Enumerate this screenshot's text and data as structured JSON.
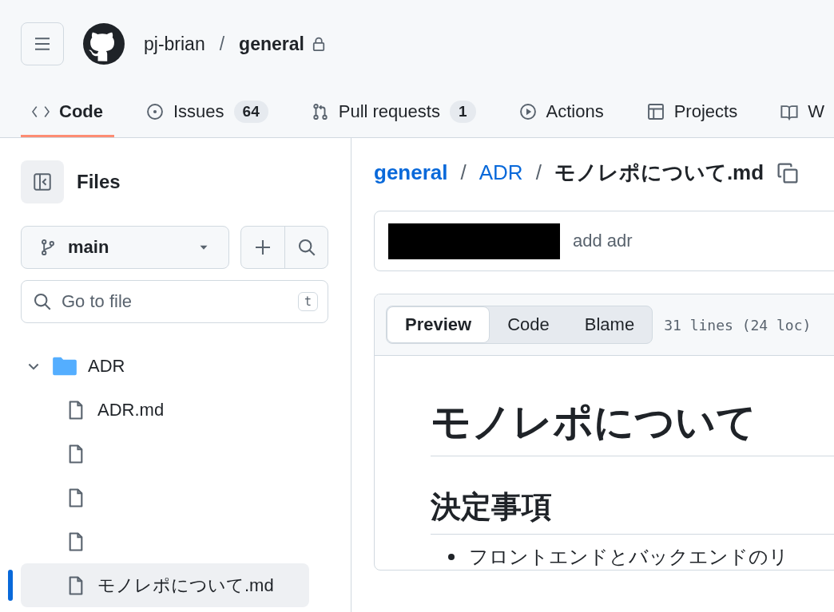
{
  "header": {
    "owner": "pj-brian",
    "separator": "/",
    "repo": "general",
    "private": true
  },
  "tabs": [
    {
      "kind": "code",
      "label": "Code",
      "selected": true
    },
    {
      "kind": "issues",
      "label": "Issues",
      "count": "64",
      "selected": false
    },
    {
      "kind": "pulls",
      "label": "Pull requests",
      "count": "1",
      "selected": false
    },
    {
      "kind": "actions",
      "label": "Actions",
      "selected": false
    },
    {
      "kind": "projects",
      "label": "Projects",
      "selected": false
    },
    {
      "kind": "wiki",
      "label": "W",
      "selected": false
    }
  ],
  "sidebar": {
    "title": "Files",
    "branch": "main",
    "search": {
      "placeholder": "Go to file",
      "shortcut": "t"
    },
    "tree": [
      {
        "kind": "folder",
        "name": "ADR",
        "expanded": true,
        "selected": false,
        "children": [
          {
            "kind": "file",
            "name": "ADR.md",
            "selected": false
          },
          {
            "kind": "file",
            "selected": false
          },
          {
            "kind": "file",
            "selected": false
          },
          {
            "kind": "file",
            "selected": false
          },
          {
            "kind": "file",
            "name": "モノレポについて.md",
            "selected": true
          }
        ]
      }
    ]
  },
  "breadcrumb": {
    "parts": [
      "general",
      "ADR"
    ],
    "separator": "/",
    "current": "モノレポについて.md"
  },
  "commit": {
    "message": "add adr"
  },
  "file_view": {
    "modes": [
      {
        "label": "Preview",
        "selected": true
      },
      {
        "label": "Code",
        "selected": false
      },
      {
        "label": "Blame",
        "selected": false
      }
    ],
    "stats": "31 lines (24 loc)"
  },
  "content": {
    "h1": "モノレポについて",
    "h2": "決定事項",
    "bullets": [
      "フロントエンドとバックエンドのリ"
    ]
  }
}
